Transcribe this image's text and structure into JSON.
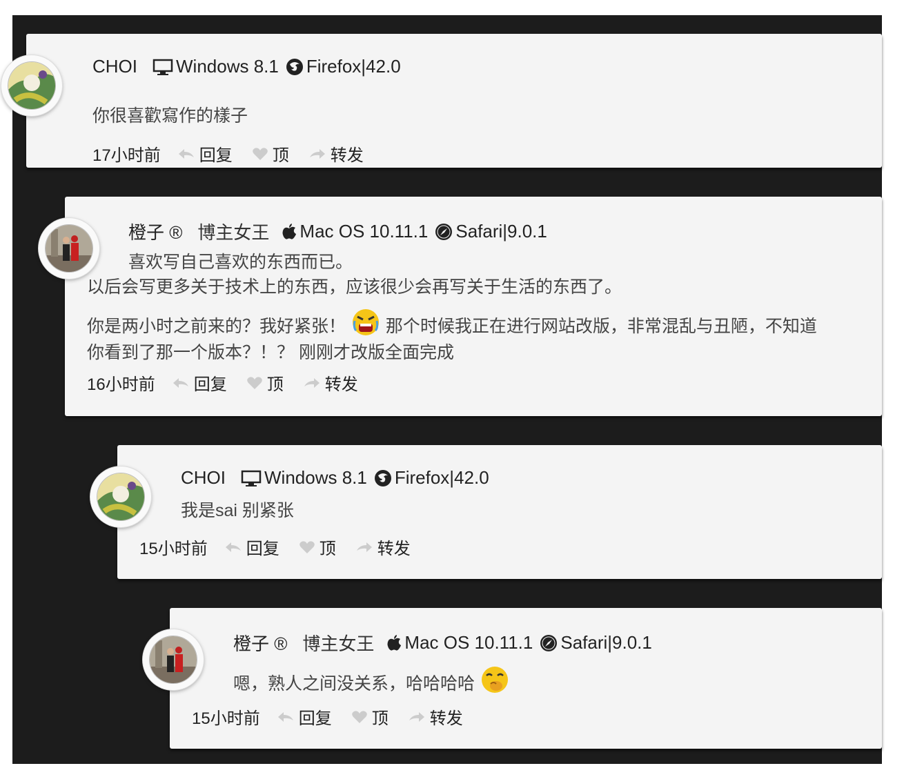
{
  "comments": [
    {
      "name": "CHOI",
      "badge": "",
      "os_icon": "monitor-icon",
      "os": "Windows 8.1",
      "browser_icon": "firefox-icon",
      "browser": "Firefox|42.0",
      "lines": [
        "你很喜歡寫作的樣子"
      ],
      "time": "17小时前",
      "reply": "回复",
      "like": "顶",
      "forward": "转发"
    },
    {
      "name": "橙子 ®",
      "badge": "博主女王",
      "os_icon": "apple-icon",
      "os": "Mac OS 10.11.1",
      "browser_icon": "safari-icon",
      "browser": "Safari|9.0.1",
      "lines": [
        "喜欢写自己喜欢的东西而已。",
        "以后会写更多关于技术上的东西，应该很少会再写关于生活的东西了。",
        "你是两小时之前来的？我好紧张！",
        "那个时候我正在进行网站改版，非常混乱与丑陋，不知道",
        "你看到了那一个版本？！？ 刚刚才改版全面完成"
      ],
      "time": "16小时前",
      "reply": "回复",
      "like": "顶",
      "forward": "转发"
    },
    {
      "name": "CHOI",
      "badge": "",
      "os_icon": "monitor-icon",
      "os": "Windows 8.1",
      "browser_icon": "firefox-icon",
      "browser": "Firefox|42.0",
      "lines": [
        "我是sai 别紧张"
      ],
      "time": "15小时前",
      "reply": "回复",
      "like": "顶",
      "forward": "转发"
    },
    {
      "name": "橙子 ®",
      "badge": "博主女王",
      "os_icon": "apple-icon",
      "os": "Mac OS 10.11.1",
      "browser_icon": "safari-icon",
      "browser": "Safari|9.0.1",
      "lines": [
        "嗯，熟人之间没关系，哈哈哈哈"
      ],
      "time": "15小时前",
      "reply": "回复",
      "like": "顶",
      "forward": "转发"
    }
  ],
  "emojis": {
    "c1": "angry-crying-emoji-icon",
    "c3": "laughing-covering-mouth-emoji-icon"
  },
  "colors": {
    "background": "#1c1c1c",
    "card": "#f4f4f4",
    "text": "#333333"
  }
}
